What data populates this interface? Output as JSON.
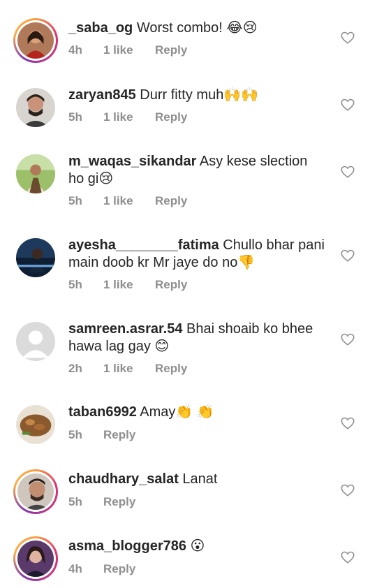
{
  "comments": [
    {
      "user": "_saba_og",
      "text": " Worst combo! 😂😢",
      "time": "4h",
      "likes": "1 like",
      "reply": "Reply"
    },
    {
      "user": "zaryan845",
      "text": " Durr fitty muh🙌🙌",
      "time": "5h",
      "likes": "1 like",
      "reply": "Reply"
    },
    {
      "user": "m_waqas_sikandar",
      "text": " Asy kese slection ho gi😢",
      "time": "5h",
      "likes": "1 like",
      "reply": "Reply"
    },
    {
      "user": "ayesha________fatima",
      "text": " Chullo bhar pani main doob kr Mr jaye do no👎",
      "time": "5h",
      "likes": "1 like",
      "reply": "Reply"
    },
    {
      "user": "samreen.asrar.54",
      "text": " Bhai shoaib ko bhee hawa lag gay 😊",
      "time": "2h",
      "likes": "1 like",
      "reply": "Reply"
    },
    {
      "user": "taban6992",
      "text": " Amay👏 👏",
      "time": "5h",
      "likes": "",
      "reply": "Reply"
    },
    {
      "user": "chaudhary_salat",
      "text": " Lanat",
      "time": "5h",
      "likes": "",
      "reply": "Reply"
    },
    {
      "user": "asma_blogger786",
      "text": " 😮",
      "time": "4h",
      "likes": "",
      "reply": "Reply"
    }
  ],
  "icons": {
    "like": "heart-outline-icon"
  },
  "colors": {
    "username": "#262626",
    "meta": "#8e8e8e",
    "story_ring": "#e1306c"
  }
}
